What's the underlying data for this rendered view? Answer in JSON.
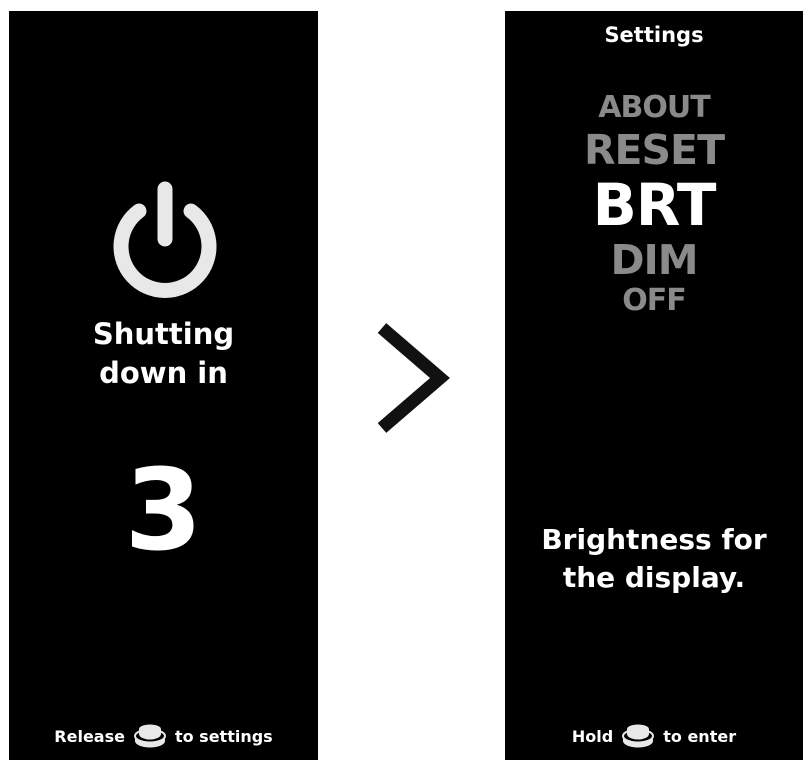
{
  "left_screen": {
    "power_icon": "power-icon",
    "shutdown_line1": "Shutting",
    "shutdown_line2": "down in",
    "countdown": "3",
    "footer_pre": "Release",
    "footer_icon": "button-icon",
    "footer_post": "to settings"
  },
  "arrow": {
    "icon": "chevron-right-icon"
  },
  "right_screen": {
    "title": "Settings",
    "menu": [
      {
        "label": "ABOUT",
        "state": "inactive"
      },
      {
        "label": "RESET",
        "state": "inactive"
      },
      {
        "label": "BRT",
        "state": "selected"
      },
      {
        "label": "DIM",
        "state": "inactive"
      },
      {
        "label": "OFF",
        "state": "inactive"
      }
    ],
    "description_line1": "Brightness for",
    "description_line2": "the display.",
    "footer_pre": "Hold",
    "footer_icon": "button-icon",
    "footer_post": "to enter"
  },
  "colors": {
    "screen_bg": "#000000",
    "text_primary": "#ffffff",
    "text_inactive": "#8a8a8a",
    "page_bg": "#ffffff",
    "icon_light": "#e8e8e8"
  }
}
